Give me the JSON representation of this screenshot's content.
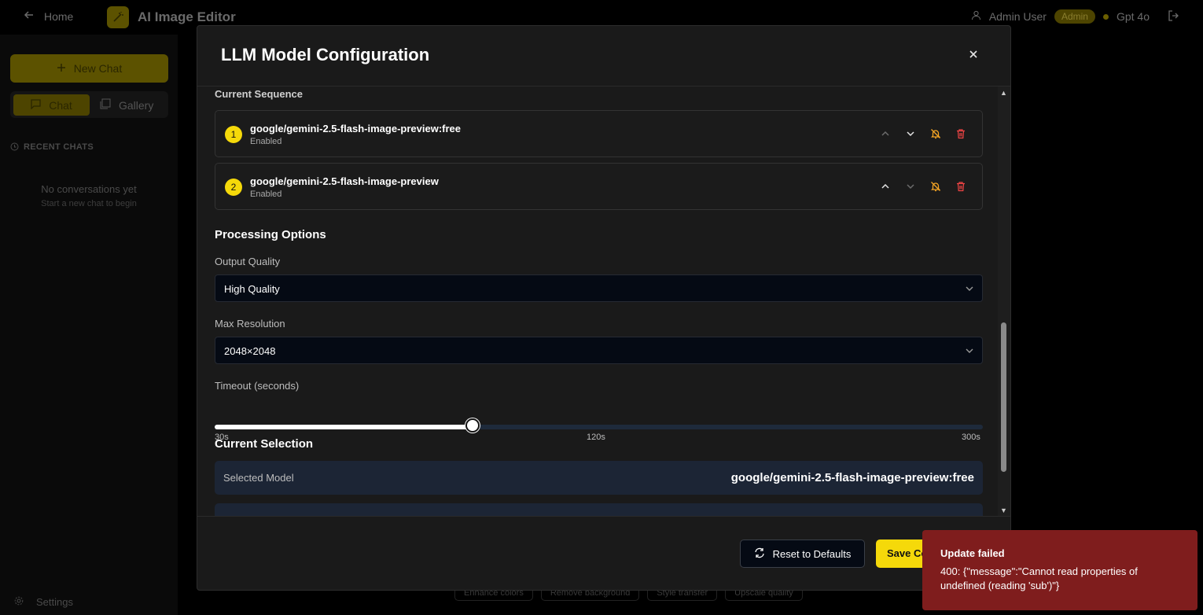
{
  "app": {
    "home_label": "Home",
    "title": "AI Image Editor",
    "user_name": "Admin User",
    "role_badge": "Admin",
    "model_indicator": "Gpt 4o"
  },
  "sidebar": {
    "new_chat_label": "New Chat",
    "tabs": [
      {
        "label": "Chat"
      },
      {
        "label": "Gallery"
      }
    ],
    "recent_label": "RECENT CHATS",
    "empty_title": "No conversations yet",
    "empty_subtitle": "Start a new chat to begin",
    "settings_label": "Settings"
  },
  "quick_actions": [
    "Enhance colors",
    "Remove background",
    "Style transfer",
    "Upscale quality"
  ],
  "modal": {
    "title": "LLM Model Configuration",
    "sequence_label": "Current Sequence",
    "sequence": [
      {
        "index": "1",
        "model": "google/gemini-2.5-flash-image-preview:free",
        "status": "Enabled"
      },
      {
        "index": "2",
        "model": "google/gemini-2.5-flash-image-preview",
        "status": "Enabled"
      }
    ],
    "processing_heading": "Processing Options",
    "output_quality": {
      "label": "Output Quality",
      "value": "High Quality"
    },
    "max_resolution": {
      "label": "Max Resolution",
      "value": "2048×2048"
    },
    "timeout": {
      "label": "Timeout (seconds)",
      "min_label": "30s",
      "mid_label": "120s",
      "max_label": "300s",
      "value_fraction": 0.336
    },
    "selection_heading": "Current Selection",
    "selected_model": {
      "label": "Selected Model",
      "value": "google/gemini-2.5-flash-image-preview:free"
    },
    "reset_label": "Reset to Defaults",
    "save_label": "Save Configuration"
  },
  "toast": {
    "title": "Update failed",
    "message": "400: {\"message\":\"Cannot read properties of undefined (reading 'sub')\"}"
  },
  "colors": {
    "accent": "#f5d90a",
    "error": "#7f1d1d",
    "modal_bg": "#1a1a1a",
    "input_bg": "#050a14"
  }
}
